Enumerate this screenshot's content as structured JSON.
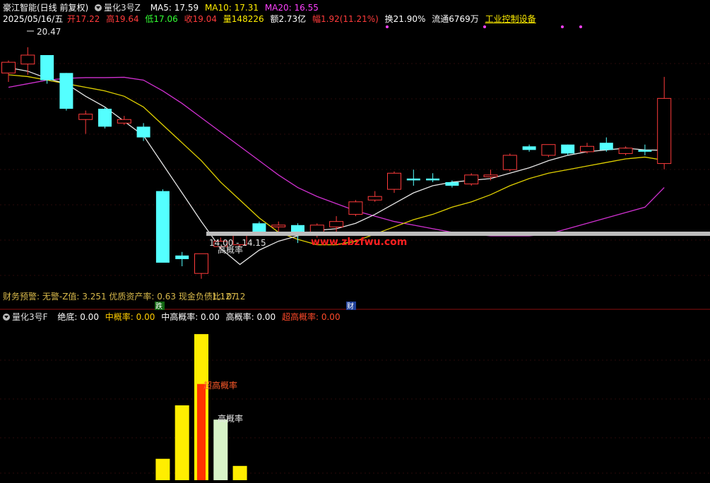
{
  "header": {
    "stock_name": "豪江智能(日线 前复权)",
    "indicator": "量化3号Z",
    "ma5": "MA5: 17.59",
    "ma10": "MA10: 17.31",
    "ma20": "MA20: 16.55",
    "date": "2025/05/16/五",
    "open": "开17.22",
    "high": "高19.64",
    "low": "低17.06",
    "close": "收19.04",
    "volume": "量148226",
    "amount": "额2.73亿",
    "change": "幅1.92(11.21%)",
    "turnover": "换21.90%",
    "float_shares": "流通6769万",
    "sector": "工业控制设备"
  },
  "lower_header": {
    "indicator": "量化3号F",
    "absolute_bottom": "绝底: 0.00",
    "medium_prob": "中概率: 0.00",
    "mid_high_prob": "中高概率: 0.00",
    "high_prob": "高概率: 0.00",
    "super_high_prob": "超高概率: 0.00"
  },
  "annotations": {
    "high_price": "20.47",
    "range_label": "14.00 - 14.15",
    "high_prob_label": "高概率",
    "watermark": "www.zbzfwu.com",
    "financial_warning": "财务预警: 无警-Z值: 3.251 优质资产率: 0.63 现金负债比: 0.12",
    "overlap_text": "1.127",
    "die_badge": "跌",
    "cai_badge": "财",
    "lower_label_top": "超高概率",
    "lower_label_bottom": "高概率"
  },
  "colors": {
    "up": "#ff3b3b",
    "down": "#54ffff",
    "ma5": "#e6e6e6",
    "ma10": "#e0d000",
    "ma20": "#d030d0",
    "yellow": "#ffee00",
    "orange": "#ff7700",
    "red_orange": "#ff3300",
    "pale": "#d8f4c8"
  },
  "chart_data": {
    "type": "candlestick",
    "ylim": [
      13.7,
      21.0
    ],
    "candles": [
      {
        "o": 19.75,
        "h": 20.1,
        "l": 19.5,
        "c": 20.05
      },
      {
        "o": 20.0,
        "h": 20.47,
        "l": 19.7,
        "c": 20.25
      },
      {
        "o": 20.25,
        "h": 20.25,
        "l": 19.45,
        "c": 19.55
      },
      {
        "o": 19.75,
        "h": 19.75,
        "l": 18.7,
        "c": 18.75
      },
      {
        "o": 18.45,
        "h": 18.7,
        "l": 18.05,
        "c": 18.6
      },
      {
        "o": 18.75,
        "h": 18.8,
        "l": 18.2,
        "c": 18.25
      },
      {
        "o": 18.35,
        "h": 18.55,
        "l": 18.3,
        "c": 18.45
      },
      {
        "o": 18.25,
        "h": 18.35,
        "l": 17.85,
        "c": 17.95
      },
      {
        "o": 16.45,
        "h": 16.5,
        "l": 14.45,
        "c": 14.45
      },
      {
        "o": 14.65,
        "h": 14.75,
        "l": 14.35,
        "c": 14.55
      },
      {
        "o": 14.15,
        "h": 14.7,
        "l": 14.0,
        "c": 14.7
      },
      {
        "o": 14.9,
        "h": 15.15,
        "l": 14.85,
        "c": 15.05
      },
      {
        "o": 14.95,
        "h": 15.25,
        "l": 14.9,
        "c": 15.25
      },
      {
        "o": 15.55,
        "h": 15.6,
        "l": 15.25,
        "c": 15.3
      },
      {
        "o": 15.45,
        "h": 15.6,
        "l": 15.2,
        "c": 15.5
      },
      {
        "o": 15.5,
        "h": 15.55,
        "l": 15.0,
        "c": 15.3
      },
      {
        "o": 15.25,
        "h": 15.55,
        "l": 15.15,
        "c": 15.5
      },
      {
        "o": 15.45,
        "h": 15.75,
        "l": 15.3,
        "c": 15.6
      },
      {
        "o": 15.8,
        "h": 16.2,
        "l": 15.75,
        "c": 16.15
      },
      {
        "o": 16.2,
        "h": 16.45,
        "l": 16.15,
        "c": 16.3
      },
      {
        "o": 16.5,
        "h": 17.0,
        "l": 16.4,
        "c": 16.95
      },
      {
        "o": 16.8,
        "h": 17.05,
        "l": 16.6,
        "c": 16.75
      },
      {
        "o": 16.8,
        "h": 16.95,
        "l": 16.7,
        "c": 16.75
      },
      {
        "o": 16.7,
        "h": 16.75,
        "l": 16.55,
        "c": 16.6
      },
      {
        "o": 16.65,
        "h": 16.95,
        "l": 16.6,
        "c": 16.9
      },
      {
        "o": 16.85,
        "h": 17.05,
        "l": 16.75,
        "c": 16.9
      },
      {
        "o": 17.05,
        "h": 17.5,
        "l": 17.0,
        "c": 17.45
      },
      {
        "o": 17.7,
        "h": 17.75,
        "l": 17.55,
        "c": 17.6
      },
      {
        "o": 17.45,
        "h": 17.75,
        "l": 17.4,
        "c": 17.75
      },
      {
        "o": 17.75,
        "h": 17.75,
        "l": 17.45,
        "c": 17.5
      },
      {
        "o": 17.55,
        "h": 17.8,
        "l": 17.5,
        "c": 17.7
      },
      {
        "o": 17.8,
        "h": 17.95,
        "l": 17.55,
        "c": 17.6
      },
      {
        "o": 17.5,
        "h": 17.7,
        "l": 17.45,
        "c": 17.65
      },
      {
        "o": 17.6,
        "h": 17.75,
        "l": 17.45,
        "c": 17.55
      },
      {
        "o": 17.22,
        "h": 19.64,
        "l": 17.06,
        "c": 19.04
      }
    ],
    "ma5": [
      19.9,
      19.8,
      19.6,
      19.45,
      19.1,
      18.8,
      18.4,
      18.0,
      17.2,
      16.4,
      15.6,
      14.85,
      14.4,
      14.8,
      15.05,
      15.2,
      15.35,
      15.4,
      15.55,
      15.8,
      16.1,
      16.4,
      16.6,
      16.7,
      16.75,
      16.8,
      16.95,
      17.1,
      17.3,
      17.45,
      17.55,
      17.6,
      17.65,
      17.6,
      17.59
    ],
    "ma10": [
      19.7,
      19.65,
      19.55,
      19.45,
      19.35,
      19.25,
      19.1,
      18.8,
      18.3,
      17.8,
      17.3,
      16.7,
      16.2,
      15.7,
      15.3,
      15.1,
      14.95,
      14.95,
      15.05,
      15.25,
      15.45,
      15.65,
      15.8,
      16.0,
      16.15,
      16.35,
      16.6,
      16.8,
      16.95,
      17.05,
      17.15,
      17.25,
      17.35,
      17.4,
      17.31
    ],
    "ma20": [
      19.35,
      19.45,
      19.55,
      19.6,
      19.62,
      19.62,
      19.63,
      19.55,
      19.25,
      18.9,
      18.5,
      18.1,
      17.7,
      17.3,
      16.9,
      16.55,
      16.3,
      16.1,
      15.9,
      15.75,
      15.6,
      15.5,
      15.4,
      15.3,
      15.25,
      15.2,
      15.2,
      15.2,
      15.25,
      15.4,
      15.55,
      15.7,
      15.85,
      16.0,
      16.55
    ],
    "support_level": 14.1,
    "lower_bars": [
      {
        "i": 8,
        "value": 30,
        "color": "yellow"
      },
      {
        "i": 9,
        "value": 105,
        "color": "yellow"
      },
      {
        "i": 10,
        "value": 205,
        "color": "yellow"
      },
      {
        "i": 10,
        "value": 135,
        "color": "red_orange"
      },
      {
        "i": 11,
        "value": 85,
        "color": "pale"
      },
      {
        "i": 12,
        "value": 20,
        "color": "yellow"
      }
    ],
    "lower_ylim": [
      0,
      220
    ]
  }
}
